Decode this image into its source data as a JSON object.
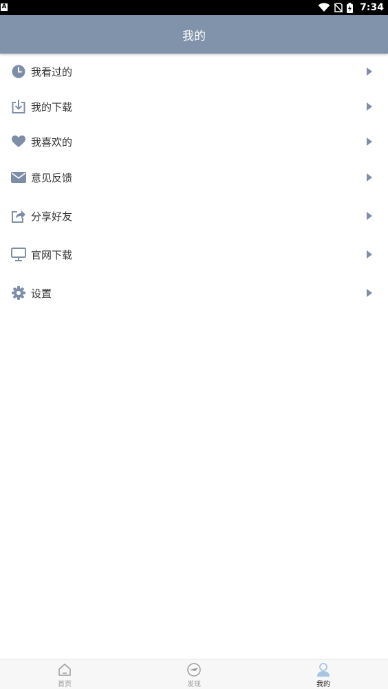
{
  "status_bar": {
    "notification_icon": "A",
    "time": "7:34",
    "icons": [
      "wifi-icon",
      "no-sim-icon",
      "battery-charging-icon"
    ]
  },
  "header": {
    "title": "我的"
  },
  "menu": [
    {
      "label": "我看过的",
      "icon": "history-clock-icon"
    },
    {
      "label": "我的下载",
      "icon": "download-icon"
    },
    {
      "label": "我喜欢的",
      "icon": "heart-icon"
    },
    {
      "label": "意见反馈",
      "icon": "envelope-icon"
    },
    {
      "label": "分享好友",
      "icon": "share-icon"
    },
    {
      "label": "官网下载",
      "icon": "monitor-icon"
    },
    {
      "label": "设置",
      "icon": "gear-icon"
    }
  ],
  "tabs": [
    {
      "label": "首页",
      "icon": "home-icon",
      "active": false
    },
    {
      "label": "发现",
      "icon": "discover-icon",
      "active": false
    },
    {
      "label": "我的",
      "icon": "profile-icon",
      "active": true
    }
  ],
  "colors": {
    "header_bg": "#8193ab",
    "icon": "#7d8ea6",
    "active_tab_icon": "#a9c4e0"
  }
}
